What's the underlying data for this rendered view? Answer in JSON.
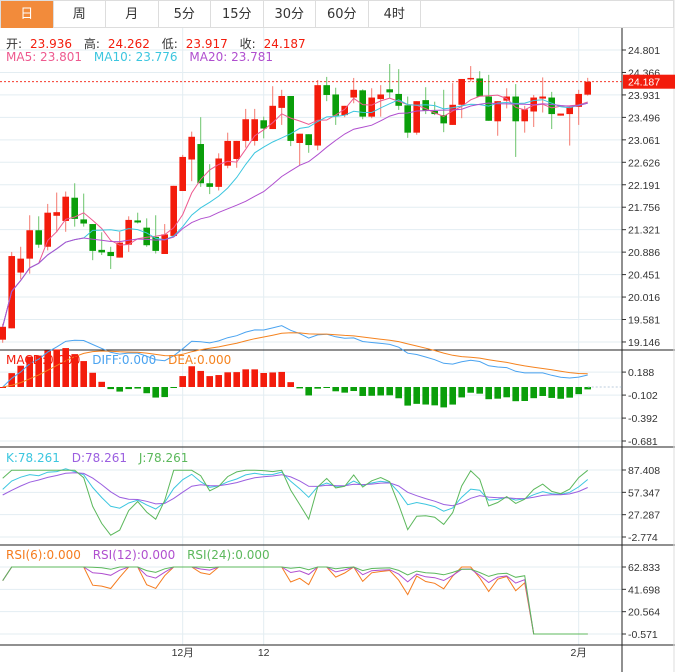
{
  "tabs": [
    "日",
    "周",
    "月",
    "5分",
    "15分",
    "30分",
    "60分",
    "4时"
  ],
  "active_tab": 0,
  "ohlc_header": {
    "open_label": "开:",
    "open": "23.936",
    "high_label": "高:",
    "high": "24.262",
    "low_label": "低:",
    "low": "23.917",
    "close_label": "收:",
    "close": "24.187"
  },
  "ma_header": {
    "ma5": "MA5: 23.801",
    "ma10": "MA10: 23.776",
    "ma20": "MA20: 23.781"
  },
  "macd_header": {
    "macd": "MACD:0.000",
    "diff": "DIFF:0.000",
    "dea": "DEA:0.000"
  },
  "kdj_header": {
    "k": "K:78.261",
    "d": "D:78.261",
    "j": "J:78.261"
  },
  "rsi_header": {
    "rsi6": "RSI(6):0.000",
    "rsi12": "RSI(12):0.000",
    "rsi24": "RSI(24):0.000"
  },
  "current_price": "24.187",
  "colors": {
    "up": "#f31c0c",
    "down": "#0a9e0a",
    "ma5": "#ee5a8f",
    "ma10": "#3cc6df",
    "ma20": "#b04fcf",
    "diff": "#4aa3f0",
    "dea": "#f5831f",
    "k": "#3cc6df",
    "d": "#9b5fe0",
    "j": "#5cb85c",
    "rsi6": "#f57c1f",
    "rsi12": "#b04fcf",
    "rsi24": "#5cb85c",
    "accent": "#f28b3b"
  },
  "chart_data": {
    "type": "candlestick",
    "price_axis_ticks": [
      "24.801",
      "24.366",
      "23.931",
      "23.496",
      "23.061",
      "22.626",
      "22.191",
      "21.756",
      "21.321",
      "20.886",
      "20.451",
      "20.016",
      "19.581",
      "19.146"
    ],
    "price_range": [
      19.146,
      24.801
    ],
    "macd_axis_ticks": [
      "0.188",
      "-0.102",
      "-0.392",
      "-0.681"
    ],
    "macd_range": [
      -0.681,
      0.188
    ],
    "kdj_axis_ticks": [
      "87.408",
      "57.347",
      "27.287",
      "-2.774"
    ],
    "kdj_range": [
      -2.774,
      87.408
    ],
    "rsi_axis_ticks": [
      "62.833",
      "41.698",
      "20.564",
      "-0.571"
    ],
    "rsi_range": [
      -0.571,
      62.833
    ],
    "x_labels": [
      {
        "index": 20,
        "label": "12月"
      },
      {
        "index": 29,
        "label": "12"
      },
      {
        "index": 64,
        "label": "2月"
      }
    ],
    "ohlc": [
      [
        19.19,
        19.5,
        19.13,
        19.44
      ],
      [
        19.41,
        20.89,
        19.41,
        20.81
      ],
      [
        20.49,
        20.99,
        20.36,
        20.76
      ],
      [
        20.76,
        21.6,
        20.47,
        21.31
      ],
      [
        21.31,
        21.58,
        20.97,
        21.03
      ],
      [
        20.99,
        21.82,
        20.92,
        21.65
      ],
      [
        21.59,
        22.04,
        21.27,
        21.66
      ],
      [
        21.49,
        22.06,
        21.28,
        21.96
      ],
      [
        21.94,
        22.22,
        21.38,
        21.53
      ],
      [
        21.52,
        22.02,
        21.38,
        21.44
      ],
      [
        21.43,
        21.43,
        20.73,
        20.91
      ],
      [
        20.93,
        21.27,
        20.83,
        20.88
      ],
      [
        20.89,
        20.99,
        20.56,
        20.81
      ],
      [
        20.78,
        21.28,
        20.78,
        21.07
      ],
      [
        21.03,
        21.58,
        20.89,
        21.51
      ],
      [
        21.5,
        21.65,
        21.44,
        21.46
      ],
      [
        21.36,
        21.54,
        20.99,
        21.02
      ],
      [
        21.18,
        21.6,
        20.86,
        20.91
      ],
      [
        20.85,
        21.43,
        20.85,
        21.23
      ],
      [
        21.2,
        22.17,
        21.2,
        22.17
      ],
      [
        22.07,
        22.77,
        22.07,
        22.73
      ],
      [
        22.68,
        23.22,
        22.26,
        23.12
      ],
      [
        22.98,
        23.5,
        22.15,
        22.22
      ],
      [
        22.22,
        22.59,
        22.01,
        22.15
      ],
      [
        22.15,
        22.8,
        22.08,
        22.7
      ],
      [
        22.56,
        23.2,
        22.51,
        23.04
      ],
      [
        22.69,
        23.04,
        22.52,
        23.04
      ],
      [
        23.04,
        23.66,
        22.91,
        23.46
      ],
      [
        23.04,
        23.66,
        22.95,
        23.46
      ],
      [
        23.44,
        23.51,
        23.09,
        23.28
      ],
      [
        23.27,
        24.1,
        23.27,
        23.72
      ],
      [
        23.68,
        24.03,
        23.35,
        23.91
      ],
      [
        23.91,
        23.91,
        22.94,
        23.04
      ],
      [
        23.0,
        23.18,
        22.57,
        23.18
      ],
      [
        23.17,
        23.17,
        22.81,
        22.96
      ],
      [
        22.95,
        24.22,
        22.86,
        24.12
      ],
      [
        24.12,
        24.28,
        23.81,
        23.93
      ],
      [
        23.94,
        24.07,
        23.35,
        23.53
      ],
      [
        23.54,
        23.72,
        23.5,
        23.72
      ],
      [
        23.88,
        24.26,
        23.77,
        24.03
      ],
      [
        24.02,
        24.04,
        23.46,
        23.51
      ],
      [
        23.51,
        24.06,
        23.48,
        23.88
      ],
      [
        23.85,
        24.12,
        23.51,
        23.94
      ],
      [
        24.04,
        24.53,
        23.86,
        23.98
      ],
      [
        23.95,
        24.43,
        23.64,
        23.72
      ],
      [
        23.73,
        23.9,
        23.1,
        23.2
      ],
      [
        23.2,
        23.81,
        23.16,
        23.81
      ],
      [
        23.83,
        24.08,
        23.56,
        23.62
      ],
      [
        23.62,
        23.8,
        23.54,
        23.56
      ],
      [
        23.54,
        24.03,
        23.21,
        23.38
      ],
      [
        23.35,
        24.16,
        23.35,
        23.74
      ],
      [
        23.74,
        24.24,
        23.48,
        24.24
      ],
      [
        24.24,
        24.49,
        24.19,
        24.26
      ],
      [
        24.25,
        24.39,
        23.9,
        23.9
      ],
      [
        23.9,
        24.32,
        23.43,
        23.43
      ],
      [
        23.42,
        23.81,
        23.14,
        23.81
      ],
      [
        23.82,
        24.06,
        23.67,
        23.9
      ],
      [
        23.9,
        24.14,
        22.73,
        23.42
      ],
      [
        23.42,
        23.72,
        23.2,
        23.65
      ],
      [
        23.61,
        23.93,
        23.31,
        23.88
      ],
      [
        23.86,
        24.27,
        23.59,
        23.9
      ],
      [
        23.88,
        23.99,
        23.27,
        23.56
      ],
      [
        23.53,
        23.57,
        23.53,
        23.57
      ],
      [
        23.56,
        23.7,
        22.95,
        23.7
      ],
      [
        23.7,
        24.03,
        23.35,
        23.95
      ],
      [
        23.936,
        24.262,
        23.917,
        24.187
      ]
    ]
  }
}
